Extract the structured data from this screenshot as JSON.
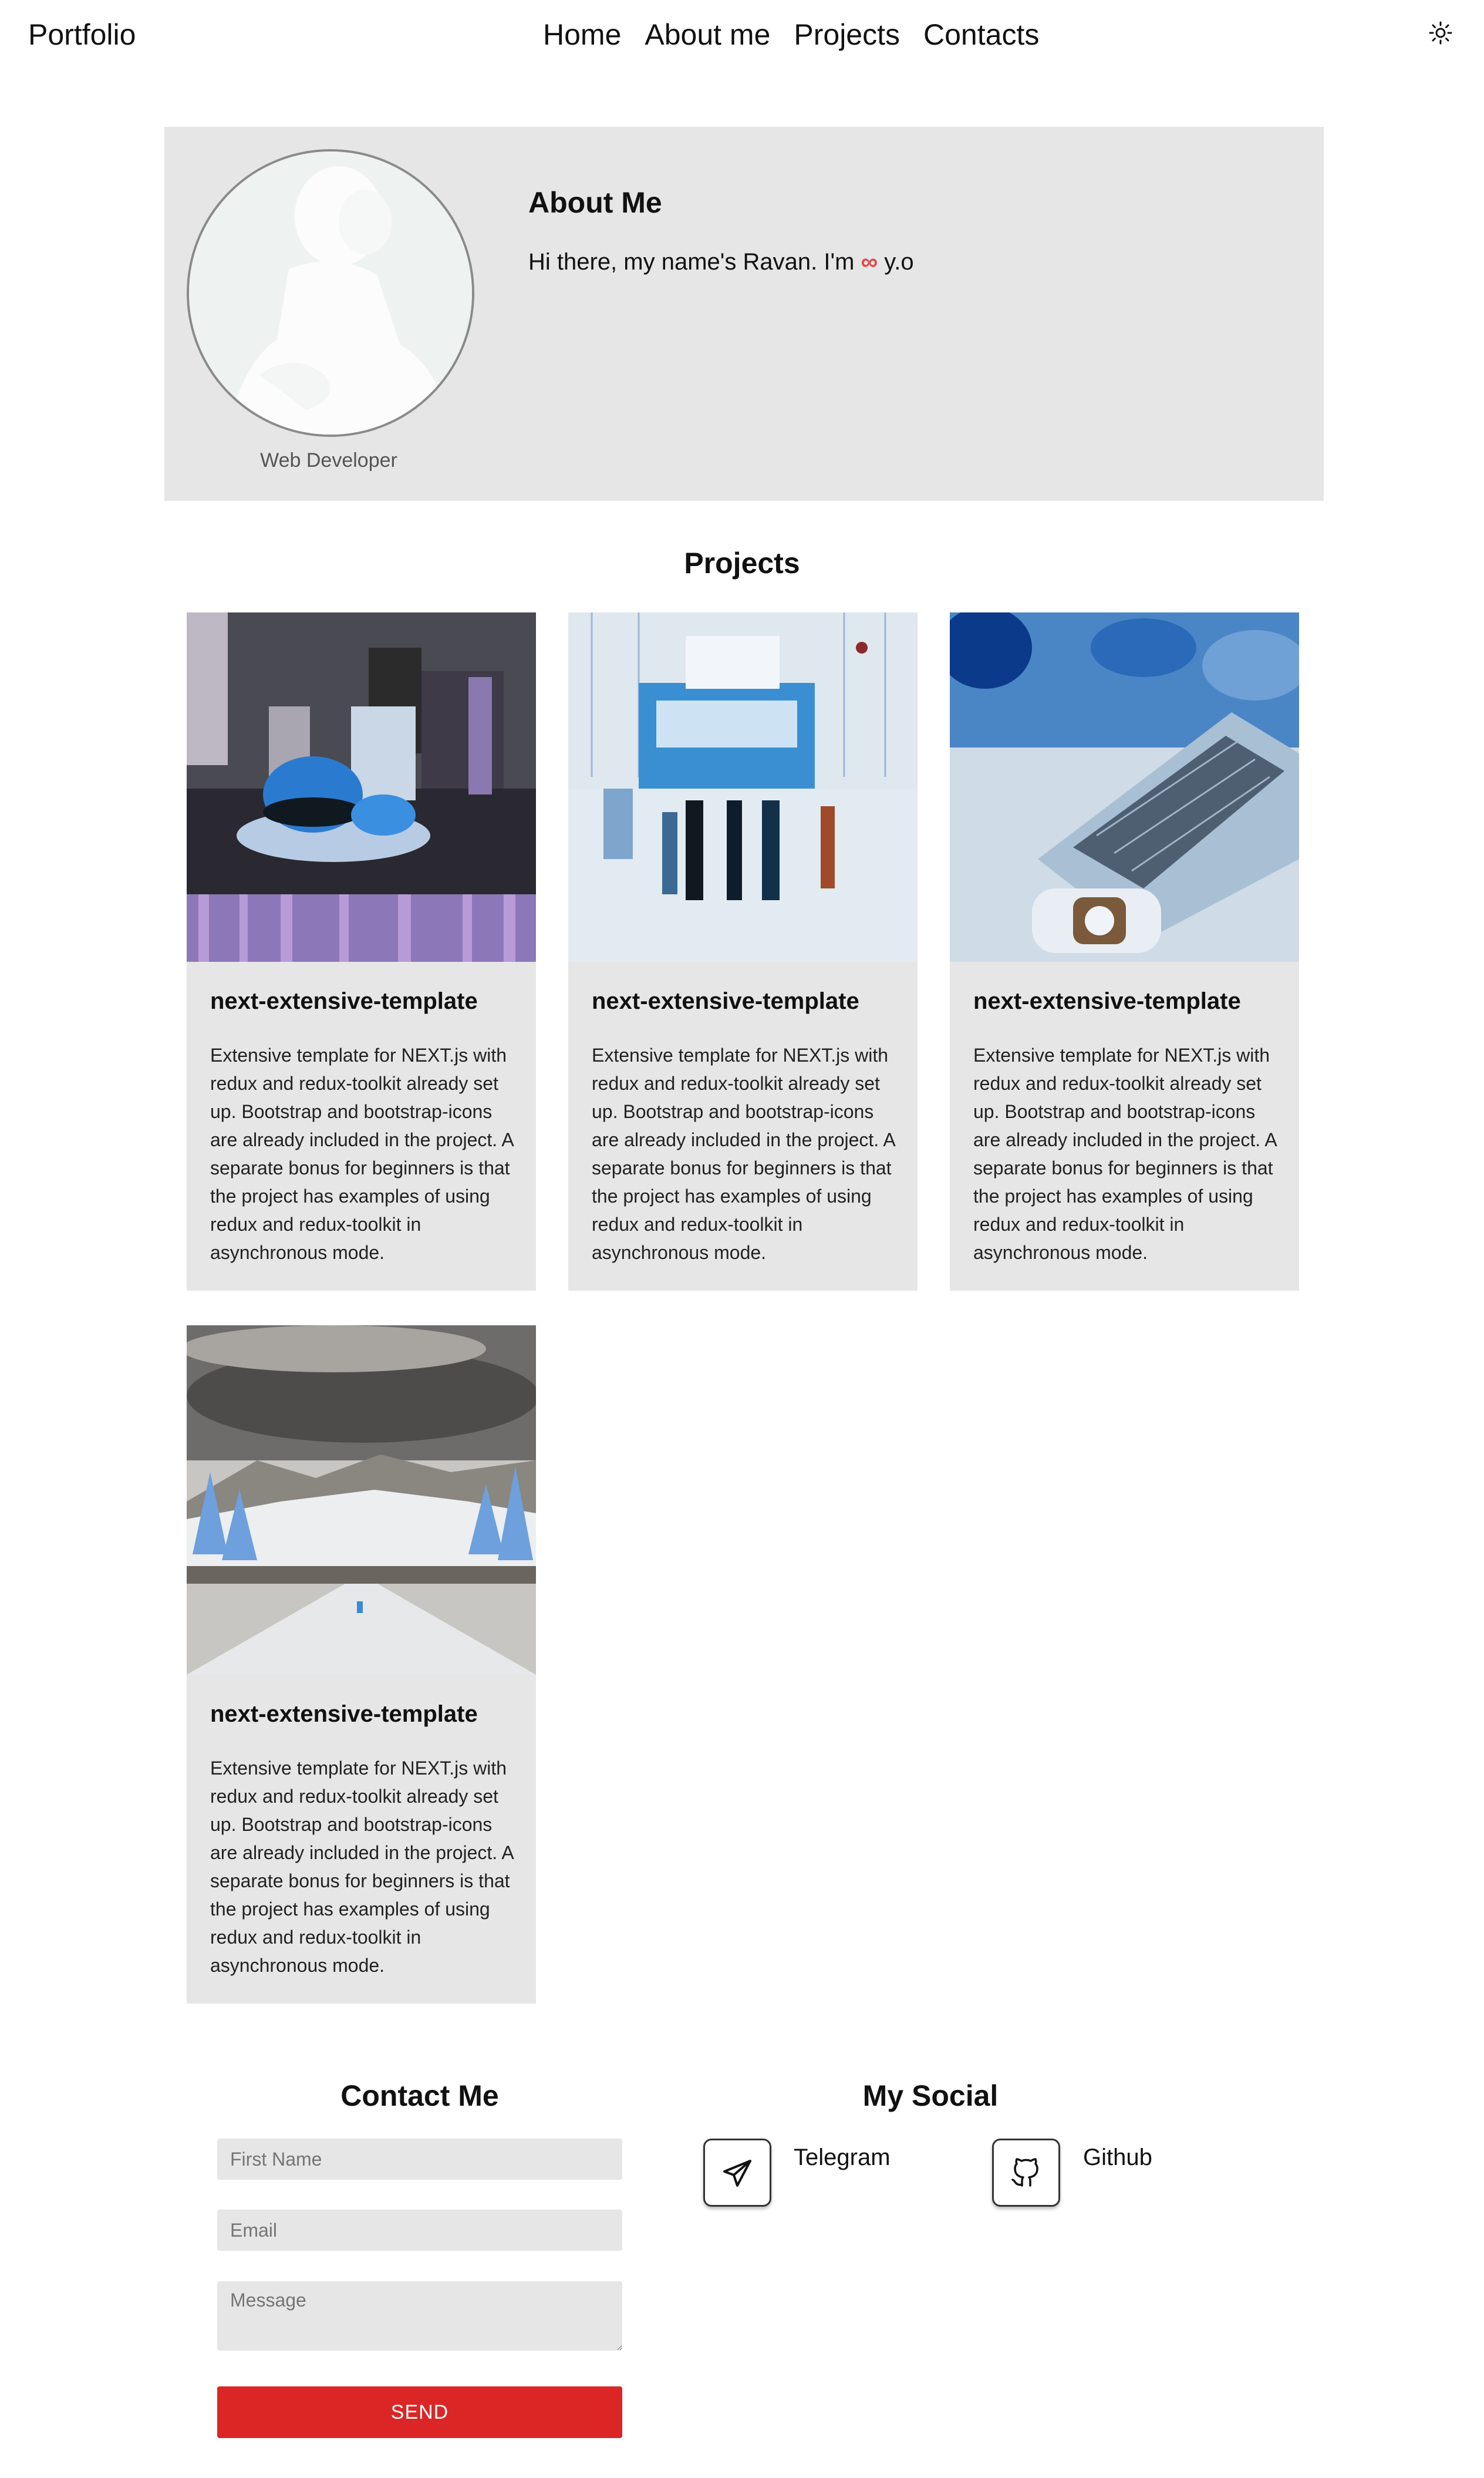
{
  "navbar": {
    "brand": "Portfolio",
    "links": [
      "Home",
      "About me",
      "Projects",
      "Contacts"
    ],
    "theme_icon": "sun-icon"
  },
  "about": {
    "title": "About Me",
    "intro_prefix": "Hi there, my name's Ravan. I'm",
    "intro_symbol": "∞",
    "intro_suffix": "y.o",
    "caption": "Web Developer"
  },
  "projects": {
    "title": "Projects",
    "items": [
      {
        "title": "next-extensive-template",
        "description": "Extensive template for NEXT.js with redux and redux-toolkit already set up. Bootstrap and bootstrap-icons are already included in the project. A separate bonus for beginners is that the project has examples of using redux and redux-toolkit in asynchronous mode."
      },
      {
        "title": "next-extensive-template",
        "description": "Extensive template for NEXT.js with redux and redux-toolkit already set up. Bootstrap and bootstrap-icons are already included in the project. A separate bonus for beginners is that the project has examples of using redux and redux-toolkit in asynchronous mode."
      },
      {
        "title": "next-extensive-template",
        "description": "Extensive template for NEXT.js with redux and redux-toolkit already set up. Bootstrap and bootstrap-icons are already included in the project. A separate bonus for beginners is that the project has examples of using redux and redux-toolkit in asynchronous mode."
      },
      {
        "title": "next-extensive-template",
        "description": "Extensive template for NEXT.js with redux and redux-toolkit already set up. Bootstrap and bootstrap-icons are already included in the project. A separate bonus for beginners is that the project has examples of using redux and redux-toolkit in asynchronous mode."
      }
    ]
  },
  "contact": {
    "title": "Contact Me",
    "first_name_placeholder": "First Name",
    "email_placeholder": "Email",
    "message_placeholder": "Message",
    "send_label": "SEND"
  },
  "social": {
    "title": "My Social",
    "items": [
      {
        "label": "Telegram",
        "icon": "telegram-icon"
      },
      {
        "label": "Github",
        "icon": "github-icon"
      }
    ]
  },
  "colors": {
    "panel_bg": "#e6e6e6",
    "send_button": "#dc2626",
    "infinity_accent": "#e04a4a"
  }
}
